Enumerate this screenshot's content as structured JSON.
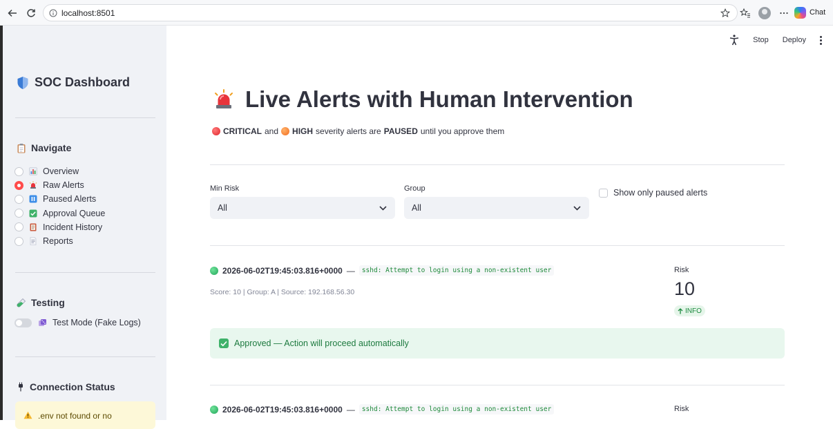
{
  "browser": {
    "url": "localhost:8501",
    "chat_label": "Chat"
  },
  "sidebar": {
    "title": "SOC Dashboard",
    "navigate_heading": "Navigate",
    "nav_items": [
      {
        "label": "Overview",
        "icon": "bar-chart-icon",
        "selected": false
      },
      {
        "label": "Raw Alerts",
        "icon": "siren-icon",
        "selected": true
      },
      {
        "label": "Paused Alerts",
        "icon": "pause-icon",
        "selected": false
      },
      {
        "label": "Approval Queue",
        "icon": "check-icon",
        "selected": false
      },
      {
        "label": "Incident History",
        "icon": "ledger-icon",
        "selected": false
      },
      {
        "label": "Reports",
        "icon": "page-icon",
        "selected": false
      }
    ],
    "testing_heading": "Testing",
    "test_mode_label": "Test Mode (Fake Logs)",
    "test_mode_on": false,
    "connection_heading": "Connection Status",
    "connection_warning": ".env not found or no"
  },
  "topbar": {
    "stop_label": "Stop",
    "deploy_label": "Deploy"
  },
  "main": {
    "title": "Live Alerts with Human Intervention",
    "subtitle": {
      "critical": "CRITICAL",
      "and": "and",
      "high": "HIGH",
      "middle": "severity alerts are",
      "paused": "PAUSED",
      "tail": "until you approve them"
    },
    "filters": {
      "min_risk_label": "Min Risk",
      "min_risk_value": "All",
      "group_label": "Group",
      "group_value": "All",
      "paused_only_label": "Show only paused alerts",
      "paused_only_checked": false
    },
    "alerts": [
      {
        "timestamp": "2026-06-02T19:45:03.816+0000",
        "separator": "—",
        "message": "sshd: Attempt to login using a non-existent user",
        "meta": "Score: 10 | Group: A | Source: 192.168.56.30",
        "risk_label": "Risk",
        "risk_value": "10",
        "risk_level": "INFO",
        "status": "Approved — Action will proceed automatically"
      },
      {
        "timestamp": "2026-06-02T19:45:03.816+0000",
        "separator": "—",
        "message": "sshd: Attempt to login using a non-existent user",
        "risk_label": "Risk"
      }
    ]
  },
  "colors": {
    "accent": "#ff4b4b",
    "sidebar_bg": "#f0f2f6",
    "success_bg": "#e8f7ee",
    "success_text": "#1d7a3f",
    "code_text": "#1f8a3b"
  }
}
